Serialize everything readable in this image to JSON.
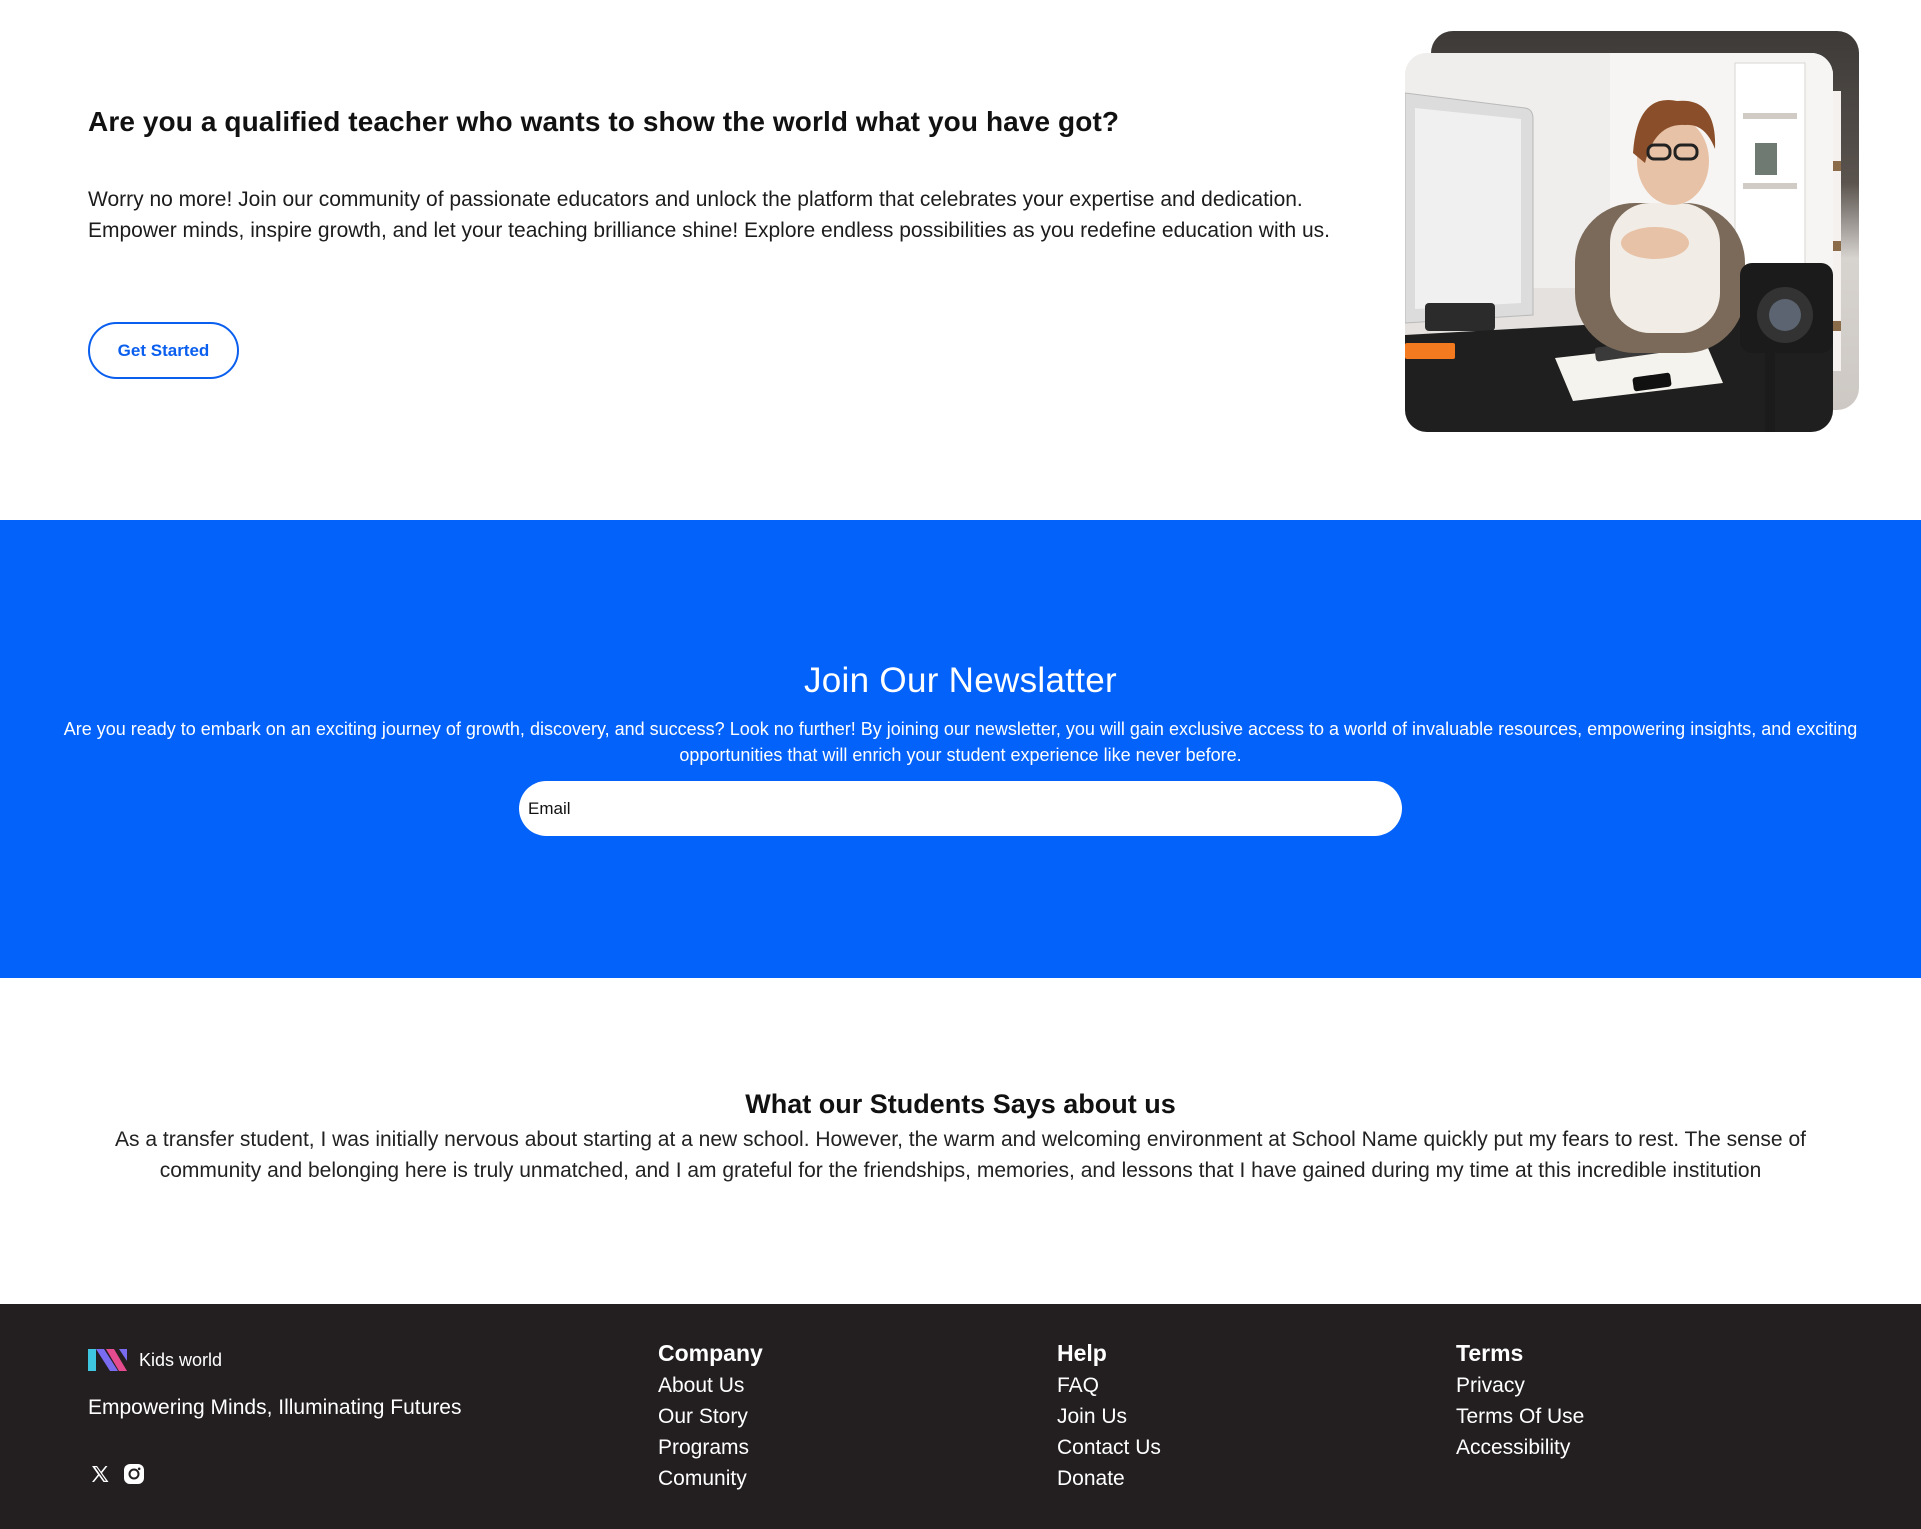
{
  "hero": {
    "title": "Are you a qualified teacher who wants to show the world what you have got?",
    "body": "Worry no more! Join our community of passionate educators and unlock the platform that celebrates your expertise and dedication. Empower minds, inspire growth, and let your teaching brilliance shine! Explore endless possibilities as you redefine education with us.",
    "cta_label": "Get Started"
  },
  "newsletter": {
    "title": "Join Our Newslatter",
    "body": "Are you ready to embark on an exciting journey of growth, discovery, and success? Look no further! By joining our newsletter, you will gain exclusive access to a world of invaluable resources, empowering insights, and exciting opportunities that will enrich your student experience like never before.",
    "email_placeholder": "Email",
    "background_color": "#0362fa"
  },
  "testimonial": {
    "title": "What our Students Says about us",
    "body": "As a transfer student, I was initially nervous about starting at a new school. However, the warm and welcoming environment at School Name quickly put my fears to rest. The sense of community and belonging here is truly unmatched, and I am grateful for the friendships, memories, and lessons that I have gained during my time at this incredible institution"
  },
  "footer": {
    "brand_name": "Kids world",
    "tagline": "Empowering Minds, Illuminating Futures",
    "social_icons": [
      "x-icon",
      "instagram-icon"
    ],
    "columns": [
      {
        "heading": "Company",
        "links": [
          "About Us",
          "Our Story",
          "Programs",
          "Comunity"
        ]
      },
      {
        "heading": "Help",
        "links": [
          "FAQ",
          "Join Us",
          "Contact Us",
          "Donate"
        ]
      },
      {
        "heading": "Terms",
        "links": [
          "Privacy",
          "Terms Of Use",
          "Accessibility"
        ]
      }
    ],
    "background_color": "#231f20"
  }
}
